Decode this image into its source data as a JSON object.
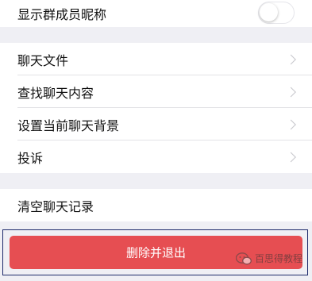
{
  "settings": {
    "show_nicknames": {
      "label": "显示群成员昵称",
      "enabled": false
    },
    "items": [
      {
        "label": "聊天文件"
      },
      {
        "label": "查找聊天内容"
      },
      {
        "label": "设置当前聊天背景"
      },
      {
        "label": "投诉"
      }
    ],
    "clear_history": {
      "label": "清空聊天记录"
    }
  },
  "actions": {
    "delete_and_exit": "删除并退出",
    "button_color": "#e64e52"
  },
  "watermark": {
    "text": "百思得教程",
    "icon": "wechat-official-account-icon"
  }
}
